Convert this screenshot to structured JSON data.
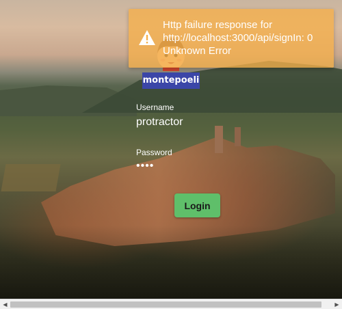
{
  "logo": {
    "text": "montepoeli",
    "banner_color": "#3b46a8"
  },
  "form": {
    "username_label": "Username",
    "username_value": "protractor",
    "password_label": "Password",
    "password_value": "••••",
    "login_label": "Login",
    "login_color": "#5fbf6a"
  },
  "toast": {
    "icon": "warning-icon",
    "message": "Http failure response for http://localhost:3000/api/signIn: 0 Unknown Error",
    "color": "#f5af4b"
  },
  "scrollbar": {
    "left_arrow": "◀",
    "right_arrow": "▶"
  }
}
